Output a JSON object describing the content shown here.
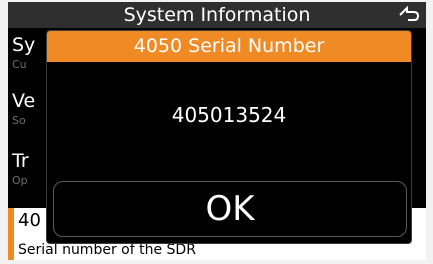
{
  "screen": {
    "title": "System Information",
    "back_icon": "back-arrow-icon"
  },
  "list": {
    "items": [
      {
        "title": "Sy",
        "subtitle": "Cu"
      },
      {
        "title": "Ve",
        "subtitle": "So"
      },
      {
        "title": "Tr",
        "subtitle": "Op"
      }
    ],
    "selected": {
      "title": "40",
      "description": "Serial number of the SDR"
    }
  },
  "dialog": {
    "title": "4050 Serial Number",
    "value": "405013524",
    "ok_label": "OK"
  },
  "colors": {
    "accent": "#f08a24",
    "titlebar": "#2f2f2f",
    "background": "#000000"
  }
}
